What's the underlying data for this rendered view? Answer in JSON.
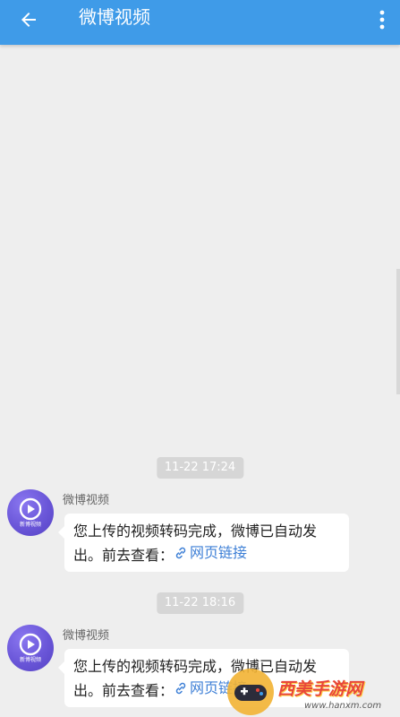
{
  "header": {
    "title": "微博视频",
    "back_icon": "arrow-left-icon",
    "more_icon": "more-vertical-icon",
    "background": "#3f9be8"
  },
  "messages": [
    {
      "time": "11-22 17:24",
      "sender": "微博视频",
      "avatar_label": "新博视频",
      "text": "您上传的视频转码完成，微博已自动发出。前去查看：",
      "link_label": "网页链接"
    },
    {
      "time": "11-22 18:16",
      "sender": "微博视频",
      "avatar_label": "新博视频",
      "text": "您上传的视频转码完成，微博已自动发出。前去查看：",
      "link_label": "网页链接"
    }
  ],
  "watermark": {
    "text": "西美手游网",
    "url": "www.hanxm.com"
  },
  "colors": {
    "link": "#3d7fd6",
    "avatar": "#6a56d8",
    "background": "#eeeeee"
  }
}
